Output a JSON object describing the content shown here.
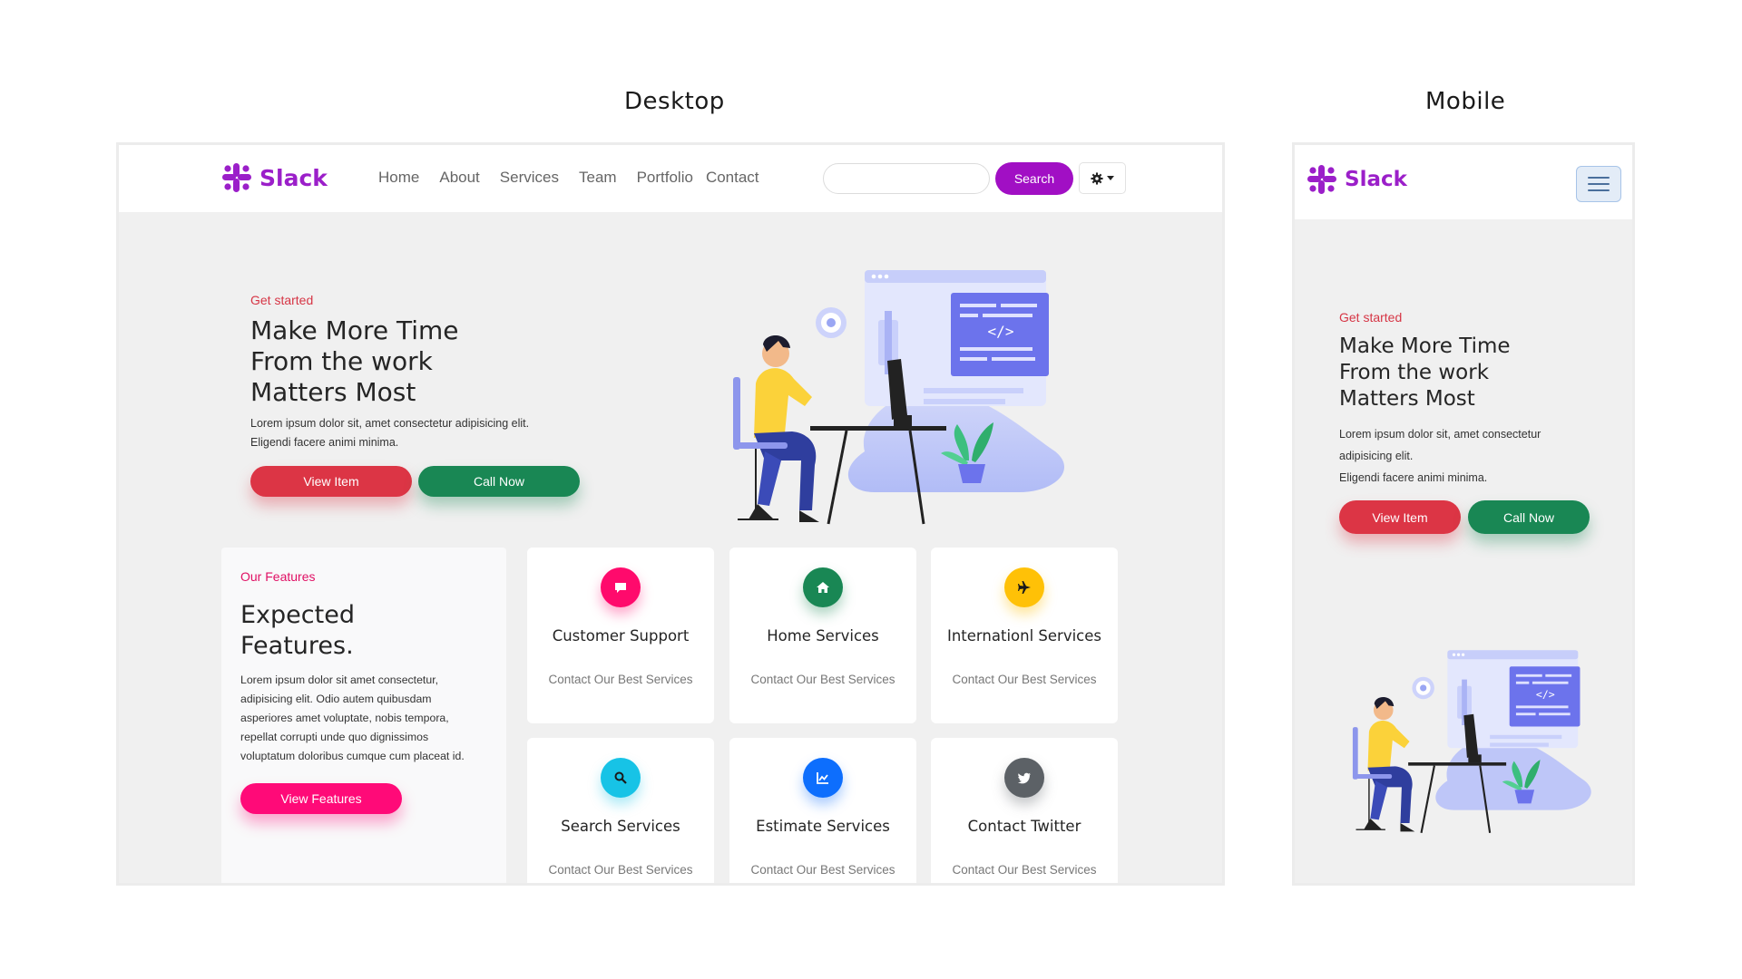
{
  "captions": {
    "desktop": "Desktop",
    "mobile": "Mobile"
  },
  "brand": {
    "name": "Slack",
    "color": "#9b1fc9"
  },
  "nav": {
    "links": [
      "Home",
      "About",
      "Services",
      "Team",
      "Portfolio",
      "Contact"
    ],
    "search_placeholder": "",
    "search_button": "Search",
    "theme_icon": "gear-icon"
  },
  "hero": {
    "tag": "Get started",
    "title_lines": [
      "Make More Time",
      "From the work",
      "Matters Most"
    ],
    "text_desktop_lines": [
      "Lorem ipsum dolor sit, amet consectetur adipisicing elit.",
      "Eligendi facere animi minima."
    ],
    "text_mobile_lines": [
      "Lorem ipsum dolor sit, amet consectetur",
      "adipisicing elit.",
      "Eligendi facere animi minima."
    ],
    "btn_primary": "View Item",
    "btn_secondary": "Call Now"
  },
  "features": {
    "tag": "Our Features",
    "title_lines": [
      "Expected",
      "Features."
    ],
    "text_lines": [
      "Lorem ipsum dolor sit amet consectetur,",
      "adipisicing elit. Odio autem quibusdam",
      "asperiores amet voluptate, nobis tempora,",
      "repellat corrupti unde quo dignissimos",
      "voluptatum doloribus cumque cum placeat id."
    ],
    "button": "View Features"
  },
  "services": [
    {
      "title": "Customer Support",
      "subtitle": "Contact Our Best Services",
      "icon": "chat-icon",
      "color": "#ff0a6c"
    },
    {
      "title": "Home Services",
      "subtitle": "Contact Our Best Services",
      "icon": "home-icon",
      "color": "#198754"
    },
    {
      "title": "Internationl Services",
      "subtitle": "Contact Our Best Services",
      "icon": "plane-icon",
      "color": "#ffc107"
    },
    {
      "title": "Search Services",
      "subtitle": "Contact Our Best Services",
      "icon": "search-icon",
      "color": "#17c3e6"
    },
    {
      "title": "Estimate Services",
      "subtitle": "Contact Our Best Services",
      "icon": "chart-icon",
      "color": "#0d6efd"
    },
    {
      "title": "Contact Twitter",
      "subtitle": "Contact Our Best Services",
      "icon": "twitter-icon",
      "color": "#5c6166"
    }
  ]
}
